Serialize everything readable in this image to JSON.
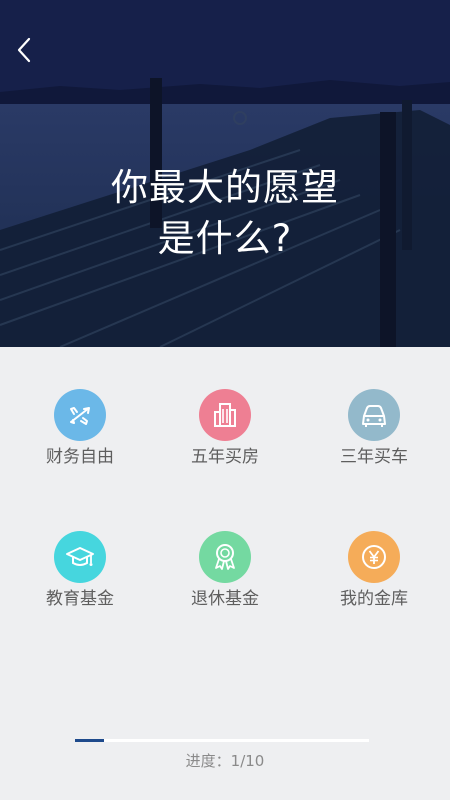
{
  "header": {
    "question_line1": "你最大的愿望",
    "question_line2": "是什么?"
  },
  "options": [
    {
      "label": "财务自由",
      "icon": "airplane-icon",
      "color": "#6bb8e8"
    },
    {
      "label": "五年买房",
      "icon": "building-icon",
      "color": "#ee7f93"
    },
    {
      "label": "三年买车",
      "icon": "car-icon",
      "color": "#93b9cb"
    },
    {
      "label": "教育基金",
      "icon": "graduation-cap-icon",
      "color": "#46d6de"
    },
    {
      "label": "退休基金",
      "icon": "medal-icon",
      "color": "#74d9a1"
    },
    {
      "label": "我的金库",
      "icon": "yen-coin-icon",
      "color": "#f5ac59"
    }
  ],
  "progress": {
    "text": "进度：1/10",
    "current": 1,
    "total": 10
  },
  "colors": {
    "progress_fill": "#1e4a8c",
    "progress_track": "#ffffff",
    "background": "#eeeff1"
  }
}
